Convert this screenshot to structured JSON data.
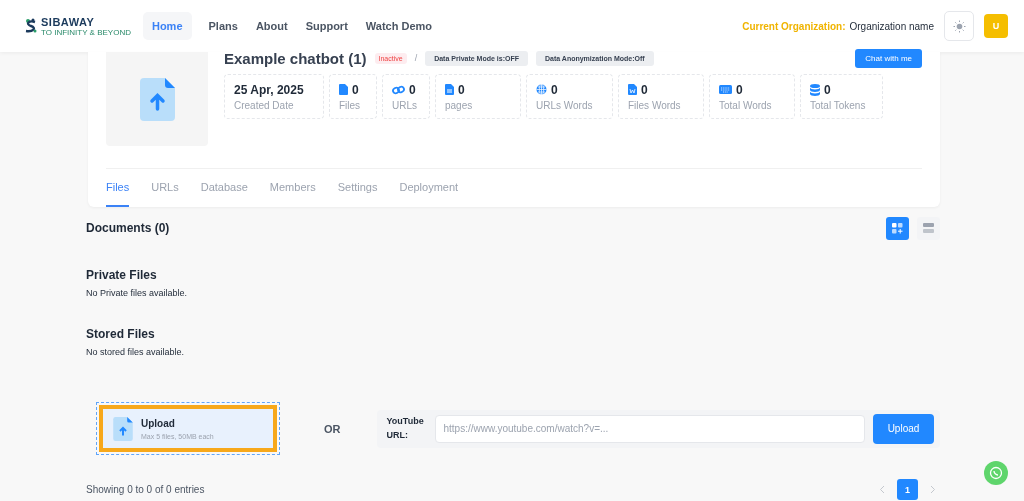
{
  "nav": {
    "logo": "SIBAWAY",
    "tagline": "TO INFINITY & BEYOND",
    "links": [
      {
        "label": "Home",
        "selected": true
      },
      {
        "label": "Plans",
        "selected": false
      },
      {
        "label": "About",
        "selected": false
      },
      {
        "label": "Support",
        "selected": false
      },
      {
        "label": "Watch Demo",
        "selected": false
      }
    ],
    "org_label": "Current Organization:",
    "org_name": "Organization name",
    "avatar": "U"
  },
  "bot": {
    "title": "Example chatbot (1)",
    "status": "Inactive",
    "separator": "/",
    "badges": [
      "Data Private Mode is:OFF",
      "Data Anonymization Mode:Off"
    ],
    "chat_button": "Chat with me",
    "stats": [
      {
        "kind": "date",
        "value": "25 Apr, 2025",
        "label": "Created Date"
      },
      {
        "kind": "file",
        "value": "0",
        "label": "Files"
      },
      {
        "kind": "link",
        "value": "0",
        "label": "URLs"
      },
      {
        "kind": "doc",
        "value": "0",
        "label": "pages"
      },
      {
        "kind": "globe",
        "value": "0",
        "label": "URLs Words"
      },
      {
        "kind": "word",
        "value": "0",
        "label": "Files Words"
      },
      {
        "kind": "keyboard",
        "value": "0",
        "label": "Total Words"
      },
      {
        "kind": "database",
        "value": "0",
        "label": "Total Tokens"
      }
    ]
  },
  "tabs": [
    {
      "label": "Files",
      "selected": true
    },
    {
      "label": "URLs",
      "selected": false
    },
    {
      "label": "Database",
      "selected": false
    },
    {
      "label": "Members",
      "selected": false
    },
    {
      "label": "Settings",
      "selected": false
    },
    {
      "label": "Deployment",
      "selected": false
    }
  ],
  "documents": {
    "title": "Documents (0)",
    "views": [
      {
        "kind": "grid",
        "selected": true
      },
      {
        "kind": "list",
        "selected": false
      }
    ]
  },
  "sections": [
    {
      "title": "Private Files",
      "empty": "No Private files available."
    },
    {
      "title": "Stored Files",
      "empty": "No stored files available."
    }
  ],
  "upload": {
    "title": "Upload",
    "hint": "Max 5 files, 50MB each",
    "or": "OR",
    "youtube_label": "YouTube URL:",
    "placeholder": "https://www.youtube.com/watch?v=...",
    "button": "Upload"
  },
  "footer": {
    "entries": "Showing 0 to 0 of 0 entries",
    "pages": [
      {
        "label": "1",
        "selected": true
      }
    ]
  }
}
